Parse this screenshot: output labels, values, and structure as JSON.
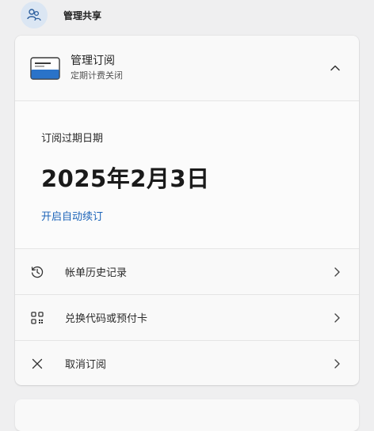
{
  "share": {
    "label": "管理共享",
    "icon": "people-icon"
  },
  "subscription": {
    "title": "管理订阅",
    "subtitle": "定期计费关闭",
    "icon": "card-icon",
    "expanded": true
  },
  "expiry": {
    "label": "订阅过期日期",
    "date": "2025年2月3日",
    "renew_link": "开启自动续订"
  },
  "menu": [
    {
      "label": "帐单历史记录",
      "icon": "history-icon"
    },
    {
      "label": "兑换代码或预付卡",
      "icon": "qr-code-icon"
    },
    {
      "label": "取消订阅",
      "icon": "close-icon"
    }
  ],
  "colors": {
    "accent": "#1b63b8",
    "page_bg": "#efeff0",
    "card_bg": "#f9f9f9",
    "share_icon_bg": "#dbe6f3"
  }
}
